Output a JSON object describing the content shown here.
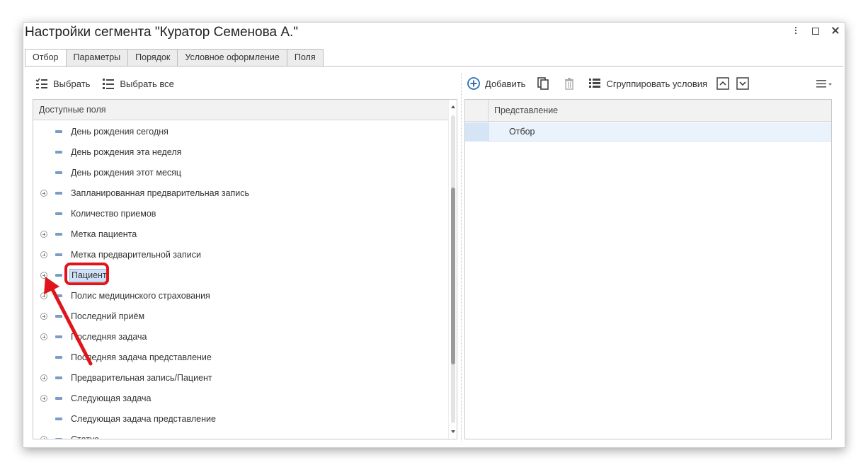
{
  "window": {
    "title": "Настройки сегмента \"Куратор Семенова А.\""
  },
  "tabs": [
    {
      "label": "Отбор",
      "active": true
    },
    {
      "label": "Параметры",
      "active": false
    },
    {
      "label": "Порядок",
      "active": false
    },
    {
      "label": "Условное оформление",
      "active": false
    },
    {
      "label": "Поля",
      "active": false
    }
  ],
  "left_toolbar": {
    "select_label": "Выбрать",
    "select_all_label": "Выбрать все"
  },
  "available_fields": {
    "header": "Доступные поля",
    "items": [
      {
        "label": "День рождения сегодня",
        "expandable": false
      },
      {
        "label": "День рождения эта неделя",
        "expandable": false
      },
      {
        "label": "День рождения этот месяц",
        "expandable": false
      },
      {
        "label": "Запланированная предварительная запись",
        "expandable": true
      },
      {
        "label": "Количество приемов",
        "expandable": false
      },
      {
        "label": "Метка пациента",
        "expandable": true
      },
      {
        "label": "Метка предварительной записи",
        "expandable": true
      },
      {
        "label": "Пациент",
        "expandable": true,
        "selected": true
      },
      {
        "label": "Полис медицинского страхования",
        "expandable": true
      },
      {
        "label": "Последний приём",
        "expandable": true
      },
      {
        "label": "Последняя задача",
        "expandable": true
      },
      {
        "label": "Последняя задача представление",
        "expandable": false
      },
      {
        "label": "Предварительная запись/Пациент",
        "expandable": true
      },
      {
        "label": "Следующая задача",
        "expandable": true
      },
      {
        "label": "Следующая задача представление",
        "expandable": false
      },
      {
        "label": "Статус",
        "expandable": true
      }
    ]
  },
  "right_toolbar": {
    "add_label": "Добавить",
    "group_label": "Сгруппировать условия"
  },
  "filter_grid": {
    "header": "Представление",
    "rows": [
      {
        "label": "Отбор"
      }
    ]
  },
  "colors": {
    "annotation": "#e0151b",
    "selection": "#cfe1f7",
    "accent": "#2f6fb5"
  }
}
